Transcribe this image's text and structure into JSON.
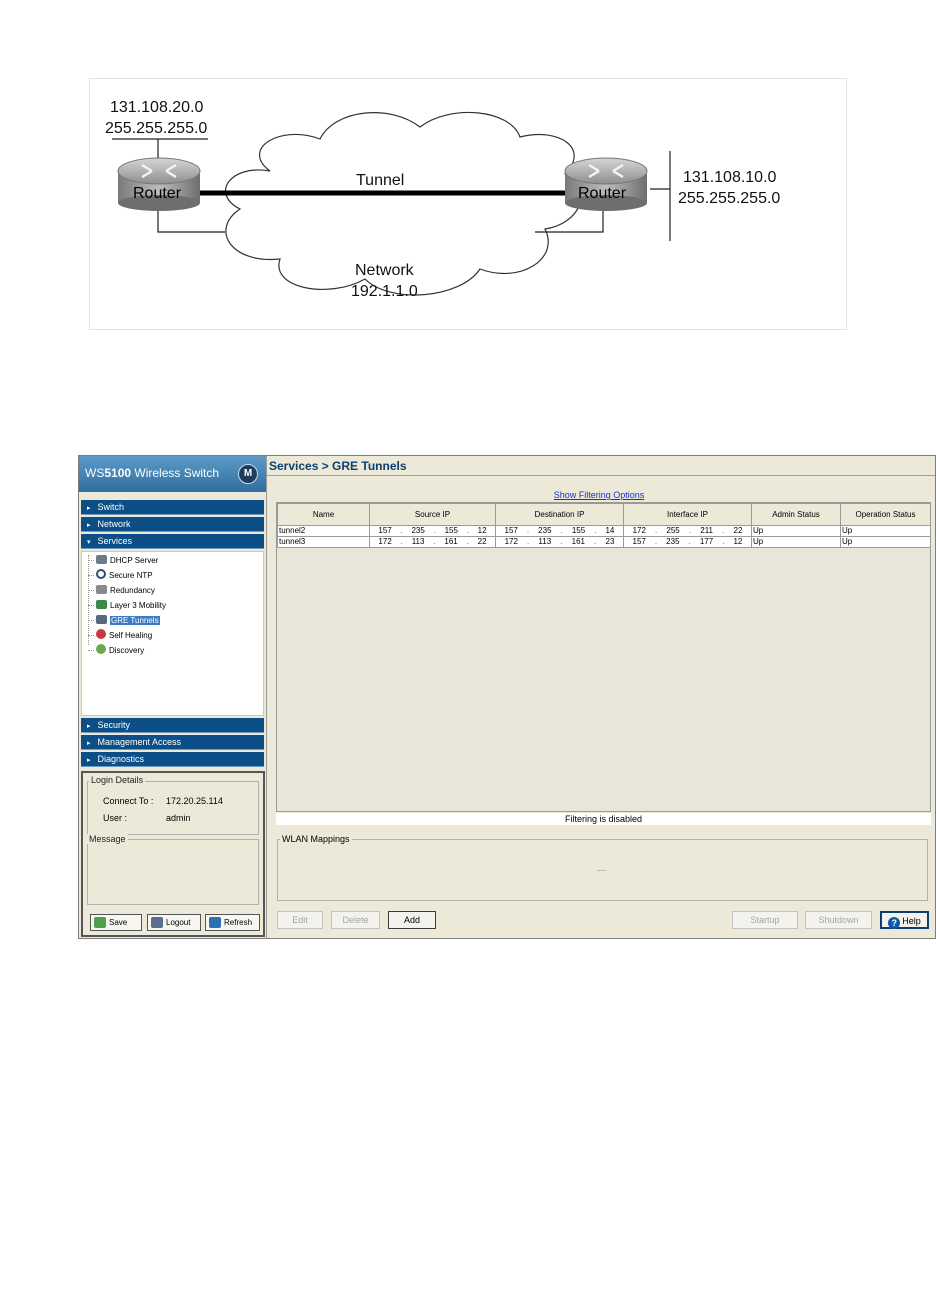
{
  "diagram": {
    "left_network": {
      "ip": "131.108.20.0",
      "mask": "255.255.255.0"
    },
    "right_network": {
      "ip": "131.108.10.0",
      "mask": "255.255.255.0"
    },
    "left_router": "Router",
    "right_router": "Router",
    "tunnel_label": "Tunnel",
    "network_label": "Network",
    "network_ip": "192.1.1.0"
  },
  "app": {
    "brand_prefix": "WS",
    "brand_model": "5100",
    "brand_suffix": " Wireless Switch",
    "logo_glyph": "M",
    "nav_top": [
      {
        "label": "Switch",
        "arrow": "▸"
      },
      {
        "label": "Network",
        "arrow": "▸"
      },
      {
        "label": "Services",
        "arrow": "▾"
      }
    ],
    "tree_items": [
      {
        "label": "DHCP Server",
        "icon": "server-icon",
        "color": "#6c7a8a"
      },
      {
        "label": "Secure NTP",
        "icon": "clock-icon",
        "color": "#2a4f7a"
      },
      {
        "label": "Redundancy",
        "icon": "printer-icon",
        "color": "#8a8a8a"
      },
      {
        "label": "Layer 3 Mobility",
        "icon": "mobility-icon",
        "color": "#3a8a4a"
      },
      {
        "label": "GRE Tunnels",
        "icon": "tunnel-icon",
        "color": "#5a6a7a"
      },
      {
        "label": "Self Healing",
        "icon": "healing-icon",
        "color": "#c83a3a"
      },
      {
        "label": "Discovery",
        "icon": "discovery-icon",
        "color": "#6aa84f"
      }
    ],
    "nav_bottom": [
      {
        "label": "Security",
        "arrow": "▸"
      },
      {
        "label": "Management Access",
        "arrow": "▸"
      },
      {
        "label": "Diagnostics",
        "arrow": "▸"
      }
    ],
    "login": {
      "title": "Login Details",
      "connect_label": "Connect To :",
      "connect_value": "172.20.25.114",
      "user_label": "User :",
      "user_value": "admin"
    },
    "message_title": "Message",
    "side_buttons": {
      "save": "Save",
      "logout": "Logout",
      "refresh": "Refresh"
    },
    "main": {
      "breadcrumb": "Services > GRE Tunnels",
      "filter_link": "Show Filtering Options",
      "columns": [
        "Name",
        "Source IP",
        "Destination IP",
        "Interface IP",
        "Admin Status",
        "Operation Status"
      ],
      "rows": [
        {
          "name": "tunnel2",
          "source": [
            "157",
            "235",
            "155",
            "12"
          ],
          "dest": [
            "157",
            "235",
            "155",
            "14"
          ],
          "iface": [
            "172",
            "255",
            "211",
            "22"
          ],
          "admin": "Up",
          "oper": "Up"
        },
        {
          "name": "tunnel3",
          "source": [
            "172",
            "113",
            "161",
            "22"
          ],
          "dest": [
            "172",
            "113",
            "161",
            "23"
          ],
          "iface": [
            "157",
            "235",
            "177",
            "12"
          ],
          "admin": "Up",
          "oper": "Up"
        }
      ],
      "filter_status": "Filtering is disabled",
      "wlan_title": "WLAN Mappings",
      "wlan_placeholder": "---",
      "buttons": {
        "edit": "Edit",
        "delete": "Delete",
        "add": "Add",
        "startup": "Startup",
        "shutdown": "Shutdown",
        "help": "Help"
      }
    }
  }
}
